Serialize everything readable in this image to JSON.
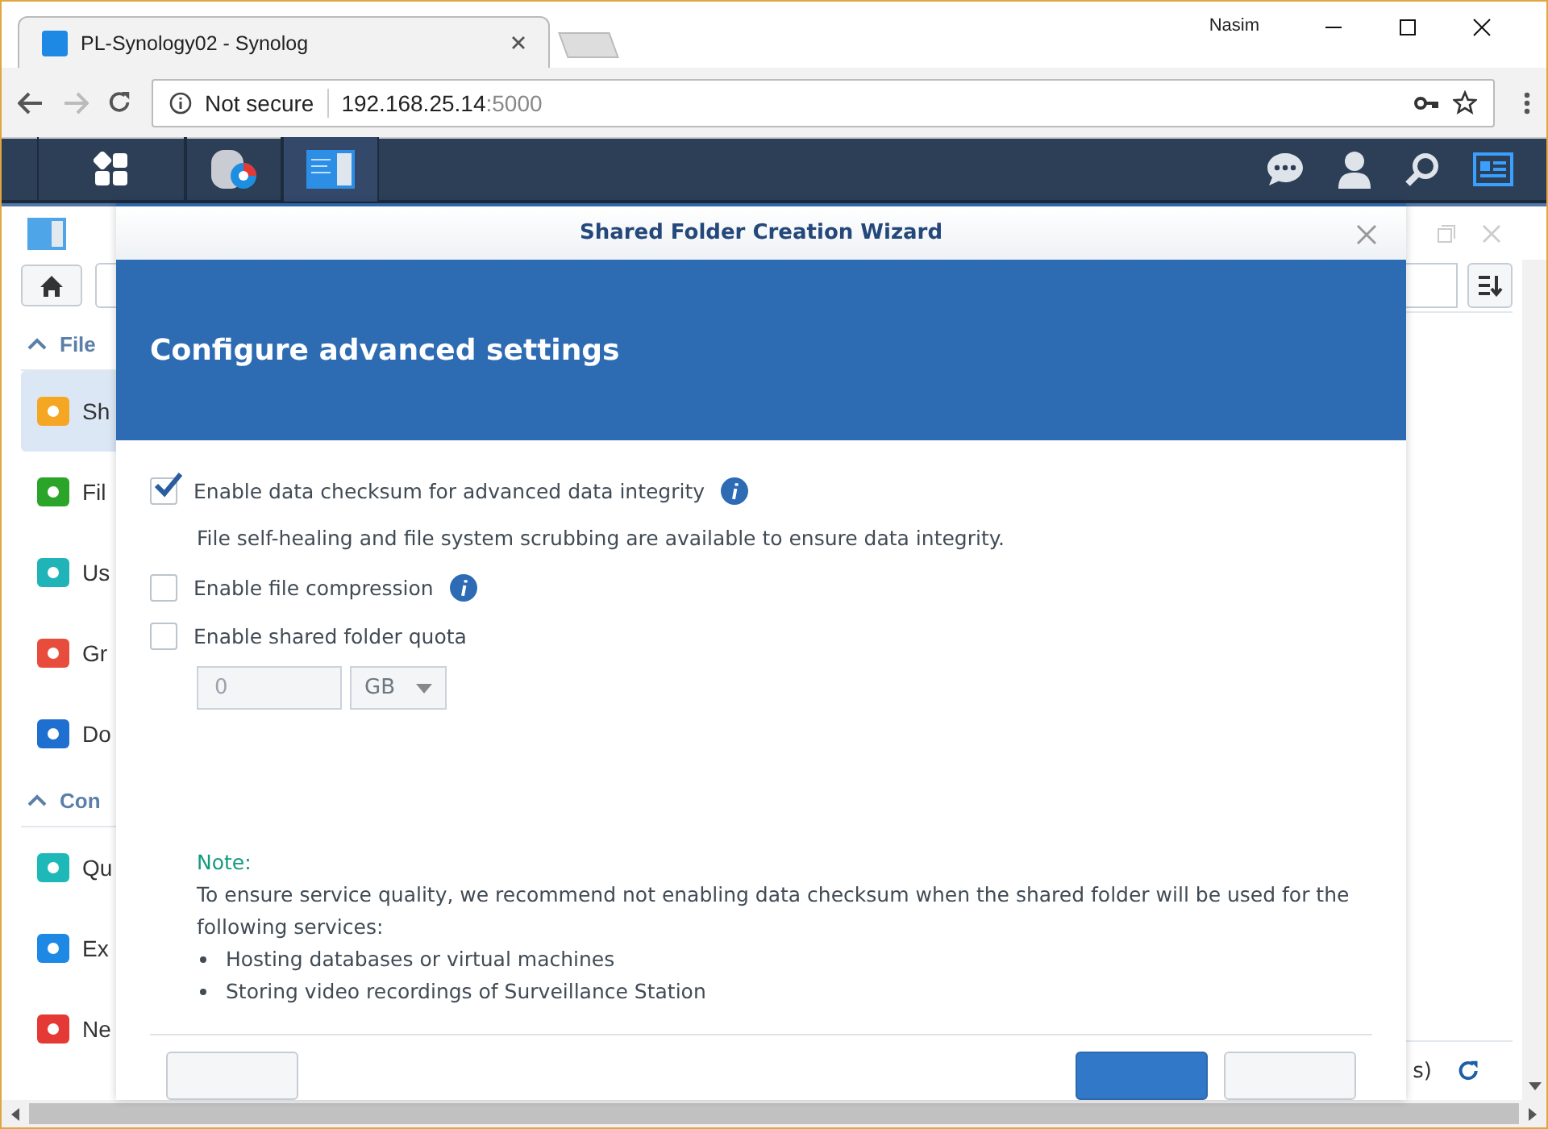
{
  "browser": {
    "tab_title": "PL-Synology02 - Synolog",
    "user": "Nasim",
    "security": "Not secure",
    "url_host": "192.168.25.14",
    "url_port": ":5000"
  },
  "sidebar": {
    "sections": [
      {
        "label": "File",
        "expanded": true,
        "items": [
          {
            "label": "Sh",
            "selected": true
          },
          {
            "label": "Fil",
            "selected": false
          },
          {
            "label": "Us",
            "selected": false
          },
          {
            "label": "Gr",
            "selected": false
          },
          {
            "label": "Do",
            "selected": false
          }
        ]
      },
      {
        "label": "Con",
        "expanded": true,
        "items": [
          {
            "label": "Qu",
            "selected": false
          },
          {
            "label": "Ex",
            "selected": false
          },
          {
            "label": "Ne",
            "selected": false
          }
        ]
      }
    ]
  },
  "status_text": "s)",
  "dialog": {
    "title": "Shared Folder Creation Wizard",
    "heading": "Configure advanced settings",
    "options": [
      {
        "label": "Enable data checksum for advanced data integrity",
        "checked": true,
        "info": true,
        "description": "File self-healing and file system scrubbing are available to ensure data integrity."
      },
      {
        "label": "Enable file compression",
        "checked": false,
        "info": true
      },
      {
        "label": "Enable shared folder quota",
        "checked": false,
        "info": false
      }
    ],
    "quota": {
      "value": "0",
      "unit": "GB",
      "disabled": true
    },
    "note": {
      "label": "Note:",
      "text": "To ensure service quality, we recommend not enabling data checksum when the shared folder will be used for the following services:",
      "bullets": [
        "Hosting databases or virtual machines",
        "Storing video recordings of Surveillance Station"
      ]
    }
  }
}
